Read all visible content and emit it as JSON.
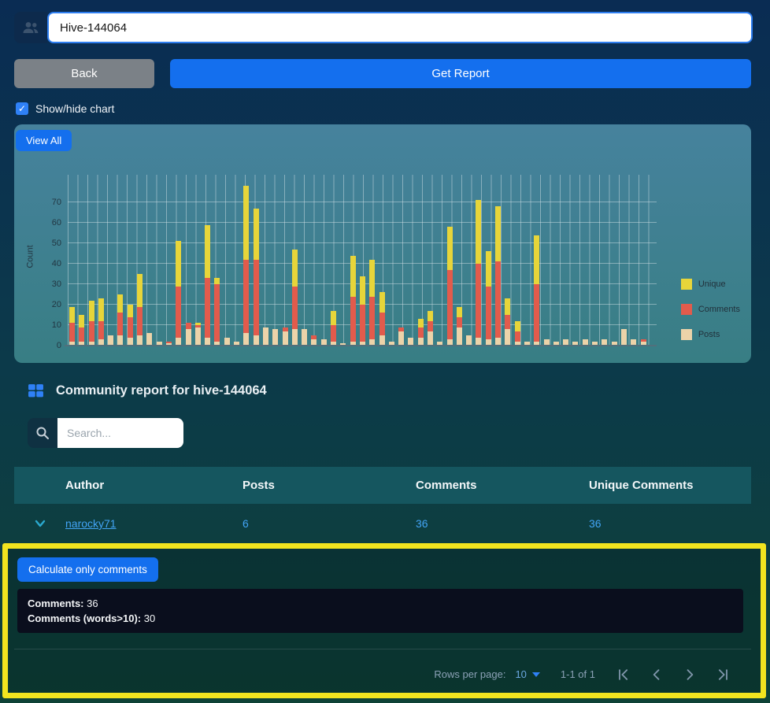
{
  "topbar": {
    "hive_input_value": "Hive-144064",
    "back_label": "Back",
    "get_report_label": "Get Report",
    "chart_toggle_label": "Show/hide chart",
    "checkbox_checked": "✓"
  },
  "chart_panel": {
    "view_all_label": "View All"
  },
  "chart_data": {
    "type": "bar",
    "stacked": true,
    "title": "",
    "xlabel": "",
    "ylabel": "Count",
    "ylim": [
      0,
      78
    ],
    "yticks": [
      0,
      10,
      20,
      30,
      40,
      50,
      60,
      70
    ],
    "grid": true,
    "legend_position": "right",
    "series": [
      {
        "name": "Posts",
        "color": "#ecd3a9",
        "values": [
          2,
          2,
          2,
          3,
          5,
          5,
          4,
          5,
          6,
          2,
          1,
          4,
          8,
          9,
          4,
          2,
          4,
          2,
          6,
          5,
          9,
          8,
          7,
          8,
          8,
          3,
          3,
          2,
          1,
          2,
          2,
          3,
          5,
          2,
          7,
          4,
          4,
          7,
          2,
          3,
          9,
          5,
          4,
          3,
          4,
          8,
          2,
          2,
          2,
          3,
          2,
          3,
          2,
          3,
          2,
          3,
          2,
          8,
          3,
          2
        ]
      },
      {
        "name": "Comments",
        "color": "#e25b4c",
        "values": [
          9,
          7,
          10,
          9,
          0,
          11,
          10,
          14,
          0,
          0,
          1,
          25,
          3,
          1,
          29,
          28,
          0,
          0,
          36,
          37,
          0,
          0,
          2,
          21,
          0,
          2,
          0,
          8,
          0,
          22,
          18,
          21,
          11,
          0,
          2,
          0,
          5,
          5,
          0,
          34,
          5,
          0,
          36,
          26,
          37,
          7,
          5,
          0,
          28,
          0,
          0,
          0,
          0,
          0,
          0,
          0,
          0,
          0,
          0,
          1
        ]
      },
      {
        "name": "Unique",
        "color": "#e7d53a",
        "values": [
          8,
          6,
          10,
          11,
          0,
          9,
          6,
          16,
          0,
          0,
          0,
          22,
          0,
          1,
          26,
          3,
          0,
          0,
          36,
          25,
          0,
          0,
          0,
          18,
          0,
          0,
          0,
          7,
          0,
          20,
          14,
          18,
          10,
          0,
          0,
          0,
          4,
          5,
          0,
          21,
          5,
          0,
          31,
          17,
          27,
          8,
          5,
          0,
          24,
          0,
          0,
          0,
          0,
          0,
          0,
          0,
          0,
          0,
          0,
          0
        ]
      }
    ]
  },
  "report": {
    "title": "Community report for hive-144064",
    "search_placeholder": "Search...",
    "columns": {
      "author": "Author",
      "posts": "Posts",
      "comments": "Comments",
      "unique_comments": "Unique Comments"
    },
    "rows": [
      {
        "author": "narocky71",
        "posts": "6",
        "comments": "36",
        "unique_comments": "36"
      }
    ],
    "detail": {
      "button_label": "Calculate only comments",
      "lines": [
        {
          "label": "Comments:",
          "value": "36"
        },
        {
          "label": "Comments (words>10):",
          "value": "30"
        }
      ]
    },
    "pagination": {
      "rows_per_page_label": "Rows per page:",
      "rows_per_page_value": "10",
      "range_label": "1-1 of 1"
    }
  },
  "colors": {
    "accent_blue": "#146fee",
    "link_blue": "#42a4f5",
    "highlight_yellow": "#f2e41f",
    "chart_panel_top": "#46829d",
    "chart_panel_bottom": "#387e84",
    "table_header": "#15565f",
    "info_box": "#0a0e1d"
  }
}
